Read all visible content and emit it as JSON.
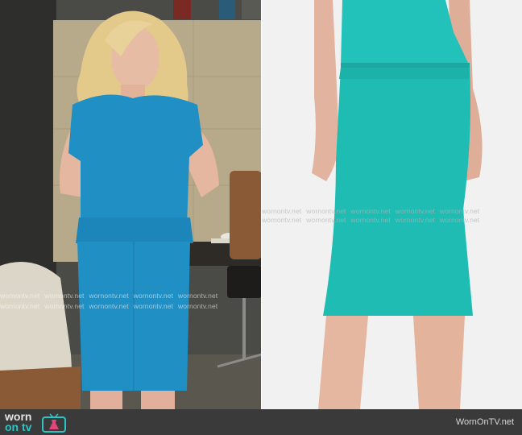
{
  "watermark": {
    "text": "wornontv.net"
  },
  "left_photo": {
    "alt_subject": "woman-in-blue-peplum-dress"
  },
  "right_photo": {
    "alt_subject": "teal-pencil-skirt-product"
  },
  "footer": {
    "logo_top": "worn",
    "logo_bottom": "on tv",
    "site": "WornOnTV.net"
  },
  "colors": {
    "dress_blue": "#1f8fc4",
    "skirt_teal": "#1fbcb4",
    "footer_bg": "#3a3a3a",
    "logo_teal": "#2fc4c4",
    "logo_pink": "#e0457b"
  }
}
